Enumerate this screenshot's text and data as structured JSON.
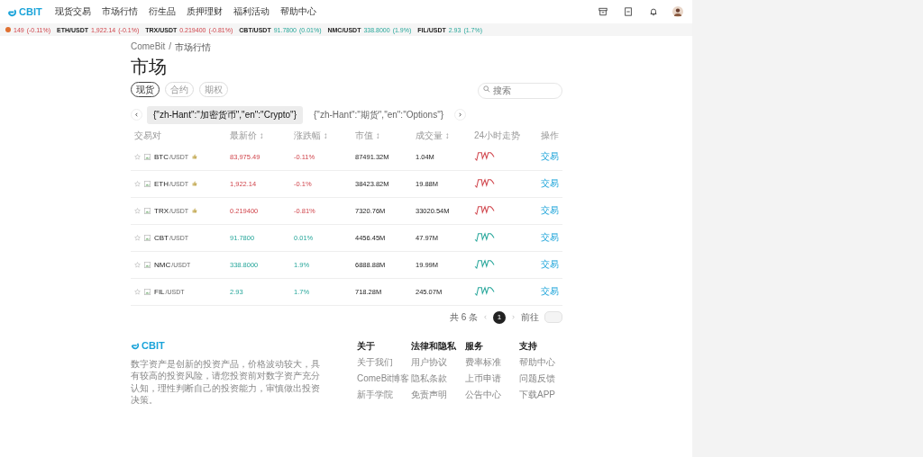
{
  "nav": {
    "logo": "CBIT",
    "items": [
      "现货交易",
      "市场行情",
      "衍生品",
      "质押理财",
      "福利活动",
      "帮助中心"
    ]
  },
  "ticker": [
    {
      "price": "149",
      "change": "(-0.11%)",
      "up": false
    },
    {
      "pair": "ETH/USDT",
      "price": "1,922.14",
      "change": "(-0.1%)",
      "up": false
    },
    {
      "pair": "TRX/USDT",
      "price": "0.219400",
      "change": "(-0.81%)",
      "up": false
    },
    {
      "pair": "CBT/USDT",
      "price": "91.7800",
      "change": "(0.01%)",
      "up": true
    },
    {
      "pair": "NMC/USDT",
      "price": "338.8000",
      "change": "(1.9%)",
      "up": true
    },
    {
      "pair": "FIL/USDT",
      "price": "2.93",
      "change": "(1.7%)",
      "up": true
    }
  ],
  "breadcrumb": [
    "ComeBit",
    "/",
    "市场行情"
  ],
  "title": "市场",
  "tabs": [
    {
      "label": "现货",
      "selected": true
    },
    {
      "label": "合约",
      "selected": false
    },
    {
      "label": "期权",
      "selected": false
    }
  ],
  "search": {
    "placeholder": "搜索"
  },
  "categories": [
    {
      "label": "{\"zh-Hant\":\"加密货币\",\"en\":\"Crypto\"}",
      "selected": true
    },
    {
      "label": "{\"zh-Hant\":\"期货\",\"en\":\"Options\"}",
      "selected": false
    }
  ],
  "table": {
    "columns": [
      "交易对",
      "最新价 ↕",
      "涨跌幅 ↕",
      "市值 ↕",
      "成交量 ↕",
      "24小时走势",
      "操作"
    ],
    "rows": [
      {
        "base": "BTC",
        "quote": "/USDT",
        "hot": true,
        "price": "83,975.49",
        "change": "-0.11%",
        "up": false,
        "cap": "87491.32M",
        "volume": "1.04M",
        "action": "交易"
      },
      {
        "base": "ETH",
        "quote": "/USDT",
        "hot": true,
        "price": "1,922.14",
        "change": "-0.1%",
        "up": false,
        "cap": "38423.82M",
        "volume": "19.88M",
        "action": "交易"
      },
      {
        "base": "TRX",
        "quote": "/USDT",
        "hot": true,
        "price": "0.219400",
        "change": "-0.81%",
        "up": false,
        "cap": "7320.76M",
        "volume": "33020.54M",
        "action": "交易"
      },
      {
        "base": "CBT",
        "quote": "/USDT",
        "hot": false,
        "price": "91.7800",
        "change": "0.01%",
        "up": true,
        "cap": "4456.45M",
        "volume": "47.97M",
        "action": "交易"
      },
      {
        "base": "NMC",
        "quote": "/USDT",
        "hot": false,
        "price": "338.8000",
        "change": "1.9%",
        "up": true,
        "cap": "6888.88M",
        "volume": "19.99M",
        "action": "交易"
      },
      {
        "base": "FIL",
        "quote": "/USDT",
        "hot": false,
        "price": "2.93",
        "change": "1.7%",
        "up": true,
        "cap": "718.28M",
        "volume": "245.07M",
        "action": "交易"
      }
    ]
  },
  "pagination": {
    "total": "共 6 条",
    "pages": [
      {
        "label": "1",
        "selected": true
      }
    ],
    "goto": "前往"
  },
  "footer": {
    "logo": "CBIT",
    "description": "数字资产是创新的投资产品，价格波动较大，具有较高的投资风险，请您投资前对数字资产充分认知，理性判断自己的投资能力，审慎做出投资决策。",
    "columns": [
      {
        "title": "关于",
        "links": [
          "关于我们",
          "ComeBit博客",
          "新手学院"
        ]
      },
      {
        "title": "法律和隐私",
        "links": [
          "用户协议",
          "隐私条款",
          "免责声明"
        ]
      },
      {
        "title": "服务",
        "links": [
          "费率标准",
          "上币申请",
          "公告中心"
        ]
      },
      {
        "title": "支持",
        "links": [
          "帮助中心",
          "问题反馈",
          "下载APP"
        ]
      }
    ]
  }
}
